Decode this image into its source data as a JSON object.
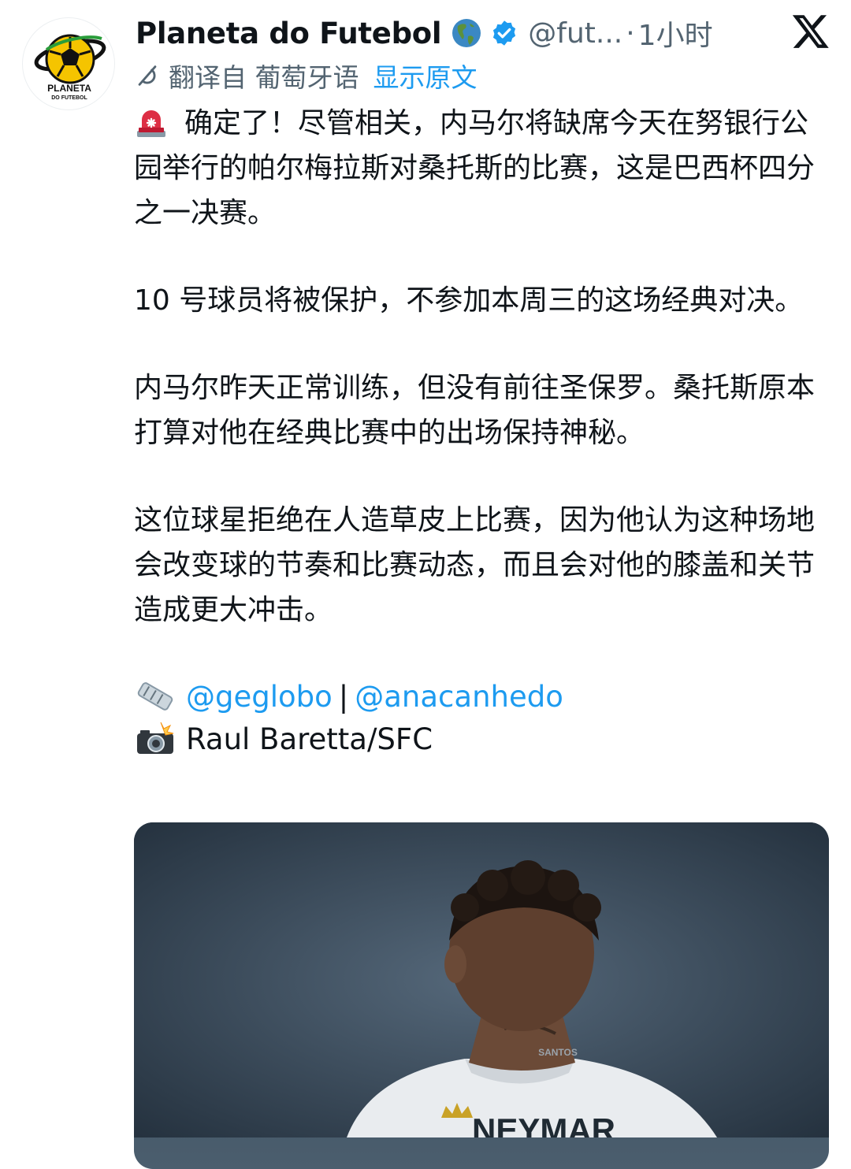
{
  "author": {
    "display_name": "Planeta do Futebol",
    "handle": "@fut...",
    "separator": "·",
    "timestamp": "1小时",
    "avatar_text": [
      "PLANETA",
      "DO FUTEBOL"
    ]
  },
  "translation": {
    "label": "翻译自 葡萄牙语",
    "show_original": "显示原文"
  },
  "tweet": {
    "paragraphs": [
      "确定了！尽管相关，内马尔将缺席今天在努银行公园举行的帕尔梅拉斯对桑托斯的比赛，这是巴西杯四分之一决赛。",
      "10 号球员将被保护，不参加本周三的这场经典对决。",
      "内马尔昨天正常训练，但没有前往圣保罗。桑托斯原本打算对他在经典比赛中的出场保持神秘。",
      "这位球星拒绝在人造草皮上比赛，因为他认为这种场地会改变球的节奏和比赛动态，而且会对他的膝盖和关节造成更大冲击。"
    ],
    "mention_1": "@geglobo",
    "mention_separator": "|",
    "mention_2": "@anacanhedo",
    "photo_credit": "Raul Baretta/SFC"
  },
  "photo": {
    "jersey_text": "SANTOS",
    "name_text": "NEYMAR"
  },
  "icons": {
    "globe": "globe-americas-icon",
    "verified": "verified-badge-icon",
    "x_logo": "x-logo-icon",
    "translate": "translate-icon",
    "siren": "rotating-light-icon",
    "newspaper": "rolled-newspaper-icon",
    "camera": "camera-flash-icon"
  },
  "colors": {
    "link": "#1d9bf0",
    "secondary_text": "#536471",
    "primary_text": "#0f1419",
    "verified": "#1d9bf0"
  }
}
